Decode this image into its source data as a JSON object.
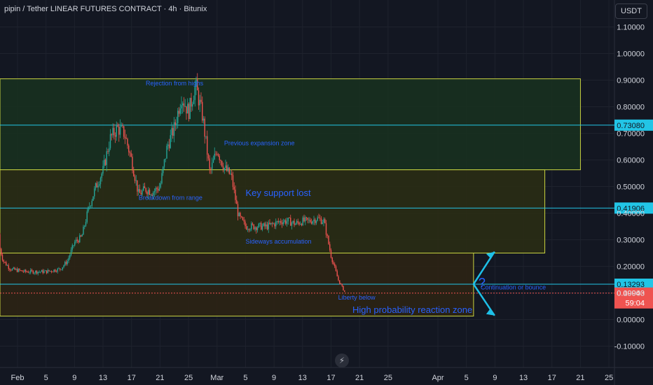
{
  "header": {
    "title": "pipin / Tether LINEAR FUTURES CONTRACT · 4h · Bitunix"
  },
  "currency_button": "USDT",
  "colors": {
    "background": "#131722",
    "grid": "#1e222d",
    "up": "#26a69a",
    "down": "#ef5350",
    "cyan_line": "#22c5e6",
    "zone_border": "#c8d341",
    "annotation_text": "#2962ff",
    "arrow": "#1ec0e8",
    "axis_text": "#d1d4dc"
  },
  "chart_data": {
    "type": "candlestick",
    "y_axis": {
      "ticks": [
        "1.10000",
        "1.00000",
        "0.90000",
        "0.80000",
        "0.70000",
        "0.60000",
        "0.50000",
        "0.40000",
        "0.30000",
        "0.20000",
        "0.10000",
        "0.00000",
        "-0.10000"
      ],
      "range": [
        -0.13,
        1.16
      ]
    },
    "x_axis": {
      "ticks": [
        "Feb",
        "5",
        "9",
        "13",
        "17",
        "21",
        "25",
        "Mar",
        "5",
        "9",
        "13",
        "17",
        "21",
        "25",
        "Apr",
        "5",
        "9",
        "13",
        "17",
        "21",
        "25"
      ]
    },
    "price_series": [
      {
        "date": "Jan 29",
        "close": 0.32
      },
      {
        "date": "Jan 30",
        "close": 0.22
      },
      {
        "date": "Jan 31",
        "close": 0.19
      },
      {
        "date": "Feb 2",
        "close": 0.18
      },
      {
        "date": "Feb 5",
        "close": 0.18
      },
      {
        "date": "Feb 7",
        "close": 0.19
      },
      {
        "date": "Feb 8",
        "close": 0.22
      },
      {
        "date": "Feb 9",
        "close": 0.29
      },
      {
        "date": "Feb 10",
        "close": 0.31
      },
      {
        "date": "Feb 11",
        "close": 0.42
      },
      {
        "date": "Feb 12",
        "close": 0.5
      },
      {
        "date": "Feb 13",
        "close": 0.56
      },
      {
        "date": "Feb 14",
        "close": 0.68
      },
      {
        "date": "Feb 15",
        "close": 0.72
      },
      {
        "date": "Feb 16",
        "close": 0.7
      },
      {
        "date": "Feb 17",
        "close": 0.6
      },
      {
        "date": "Feb 18",
        "close": 0.47
      },
      {
        "date": "Feb 19",
        "close": 0.49
      },
      {
        "date": "Feb 20",
        "close": 0.48
      },
      {
        "date": "Feb 21",
        "close": 0.5
      },
      {
        "date": "Feb 22",
        "close": 0.65
      },
      {
        "date": "Feb 23",
        "close": 0.72
      },
      {
        "date": "Feb 24",
        "close": 0.84
      },
      {
        "date": "Feb 25",
        "close": 0.78
      },
      {
        "date": "Feb 26",
        "close": 0.88
      },
      {
        "date": "Feb 27",
        "close": 0.76
      },
      {
        "date": "Feb 28",
        "close": 0.55
      },
      {
        "date": "Mar 1",
        "close": 0.64
      },
      {
        "date": "Mar 2",
        "close": 0.57
      },
      {
        "date": "Mar 3",
        "close": 0.54
      },
      {
        "date": "Mar 4",
        "close": 0.39
      },
      {
        "date": "Mar 5",
        "close": 0.35
      },
      {
        "date": "Mar 6",
        "close": 0.35
      },
      {
        "date": "Mar 8",
        "close": 0.35
      },
      {
        "date": "Mar 9",
        "close": 0.36
      },
      {
        "date": "Mar 10",
        "close": 0.37
      },
      {
        "date": "Mar 11",
        "close": 0.37
      },
      {
        "date": "Mar 12",
        "close": 0.36
      },
      {
        "date": "Mar 13",
        "close": 0.37
      },
      {
        "date": "Mar 14",
        "close": 0.37
      },
      {
        "date": "Mar 15",
        "close": 0.38
      },
      {
        "date": "Mar 16",
        "close": 0.37
      },
      {
        "date": "Mar 17",
        "close": 0.24
      },
      {
        "date": "Mar 18",
        "close": 0.15
      },
      {
        "date": "Mar 19",
        "close": 0.0994
      }
    ],
    "horizontal_levels": [
      {
        "label": "0.73080",
        "value": 0.7308,
        "color": "#22c5e6"
      },
      {
        "label": "0.41906",
        "value": 0.41906,
        "color": "#22c5e6"
      },
      {
        "label": "0.13293",
        "value": 0.13293,
        "color": "#22c5e6"
      }
    ],
    "current_price": {
      "label": "0.09943",
      "value": 0.09943,
      "countdown": "59:04",
      "color": "#ef5350"
    },
    "zones": [
      {
        "name": "upper-zone",
        "top": 0.905,
        "bottom": 0.563,
        "color": "#c8d341",
        "fill": "#18301f",
        "x_end": "Apr 21"
      },
      {
        "name": "middle-zone",
        "top": 0.563,
        "bottom": 0.25,
        "color": "#c8d341",
        "fill": "#2a2c14",
        "x_end": "Apr 16"
      },
      {
        "name": "lower-zone",
        "top": 0.25,
        "bottom": 0.013,
        "color": "#c8d341",
        "fill": "#2c2314",
        "x_end": "Apr 6"
      }
    ],
    "annotations": [
      {
        "text": "Rejection from highs",
        "date": "Feb 19",
        "value": 0.88,
        "size": 9
      },
      {
        "text": "Previous expansion zone",
        "date": "Mar 2",
        "value": 0.655,
        "size": 9
      },
      {
        "text": "Key support lost",
        "date": "Mar 5",
        "value": 0.465,
        "size": 13
      },
      {
        "text": "Breakdown from range",
        "date": "Feb 18",
        "value": 0.45,
        "size": 9
      },
      {
        "text": "Sideways accumulation",
        "date": "Mar 5",
        "value": 0.285,
        "size": 9
      },
      {
        "text": "Liberty below",
        "date": "Mar 18",
        "value": 0.075,
        "size": 9
      },
      {
        "text": "High probability reaction zone",
        "date": "Mar 20",
        "value": 0.025,
        "size": 13
      },
      {
        "text": "Continuation or bounce",
        "date": "Apr 7",
        "value": 0.113,
        "size": 9
      }
    ],
    "question_mark": "?"
  }
}
